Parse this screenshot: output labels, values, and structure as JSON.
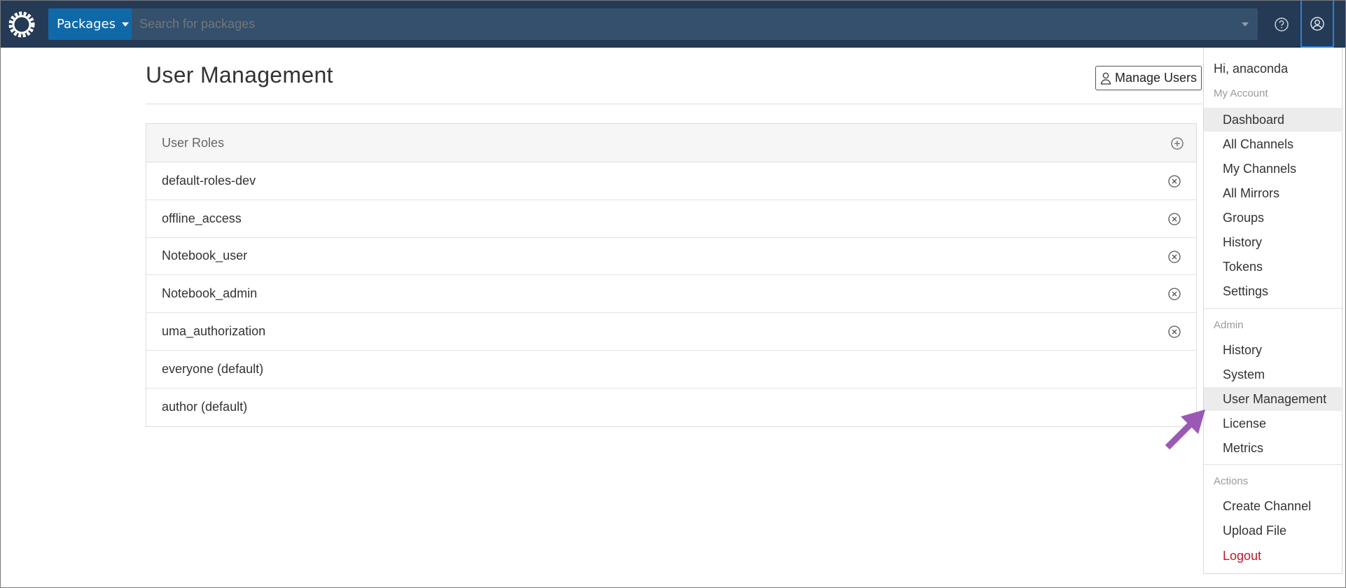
{
  "navbar": {
    "packages_label": "Packages",
    "search_placeholder": "Search for packages"
  },
  "main": {
    "page_title": "User Management",
    "manage_users_label": "Manage Users",
    "roles_header": "User Roles",
    "roles": [
      {
        "name": "default-roles-dev",
        "removable": true
      },
      {
        "name": "offline_access",
        "removable": true
      },
      {
        "name": "Notebook_user",
        "removable": true
      },
      {
        "name": "Notebook_admin",
        "removable": true
      },
      {
        "name": "uma_authorization",
        "removable": true
      },
      {
        "name": "everyone (default)",
        "removable": false
      },
      {
        "name": "author (default)",
        "removable": false
      }
    ]
  },
  "menu": {
    "greeting": "Hi, anaconda",
    "my_account": {
      "heading": "My Account",
      "items": [
        "Dashboard",
        "All Channels",
        "My Channels",
        "All Mirrors",
        "Groups",
        "History",
        "Tokens",
        "Settings"
      ]
    },
    "admin": {
      "heading": "Admin",
      "items": [
        "History",
        "System",
        "User Management",
        "License",
        "Metrics"
      ]
    },
    "actions": {
      "heading": "Actions",
      "items": [
        "Create Channel",
        "Upload File",
        "Logout"
      ]
    }
  },
  "colors": {
    "navbar": "#243a55",
    "packages_button": "#0f69a8",
    "search_field": "#34506d",
    "logout": "#c0182a",
    "callout_arrow": "#9b59b6"
  },
  "icons": [
    "anaconda-logo-icon",
    "caret-down-icon",
    "help-icon",
    "user-circle-icon",
    "person-icon",
    "plus-circle-icon",
    "x-circle-icon",
    "callout-arrow-icon"
  ]
}
